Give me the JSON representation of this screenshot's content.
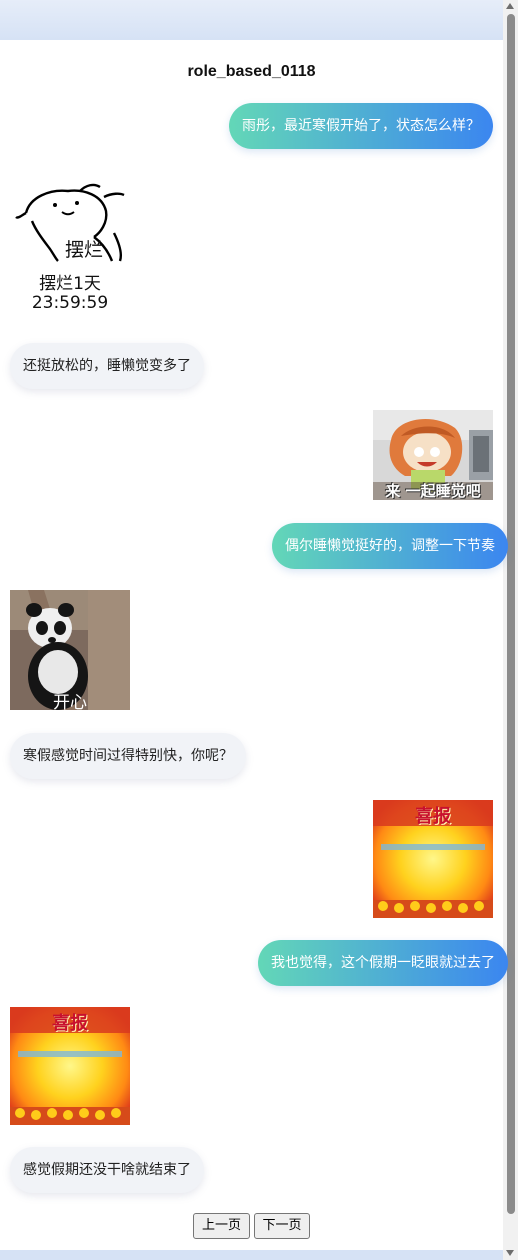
{
  "page": {
    "title": "role_based_0118"
  },
  "messages": [
    {
      "side": "right",
      "type": "text",
      "text": "雨彤，最近寒假开始了，状态怎么样？"
    },
    {
      "side": "left",
      "type": "sticker",
      "caption_img": "摆烂",
      "line1": "摆烂1天",
      "line2": "23:59:59",
      "icon": "lying-flat-sticker"
    },
    {
      "side": "left",
      "type": "text",
      "text": "还挺放松的，睡懒觉变多了"
    },
    {
      "side": "right",
      "type": "sticker",
      "caption_img": "来 一起睡觉吧",
      "icon": "anime-girl-sleep-sticker"
    },
    {
      "side": "right",
      "type": "text",
      "text": "偶尔睡懒觉挺好的，调整一下节奏"
    },
    {
      "side": "left",
      "type": "sticker",
      "caption_img": "开心",
      "icon": "panda-sticker"
    },
    {
      "side": "left",
      "type": "text",
      "text": "寒假感觉时间过得特别快，你呢？"
    },
    {
      "side": "right",
      "type": "sticker",
      "caption_img": "喜报",
      "icon": "good-news-poster-sticker"
    },
    {
      "side": "right",
      "type": "text",
      "text": "我也觉得，这个假期一眨眼就过去了"
    },
    {
      "side": "left",
      "type": "sticker",
      "caption_img": "喜报",
      "icon": "good-news-poster-sticker"
    },
    {
      "side": "left",
      "type": "text",
      "text": "感觉假期还没干啥就结束了"
    }
  ],
  "pagination": {
    "prev_label": "上一页",
    "next_label": "下一页"
  },
  "colors": {
    "bubble_right_start": "#63d7b7",
    "bubble_right_end": "#3b86f0",
    "bubble_left": "#f1f3f7"
  }
}
